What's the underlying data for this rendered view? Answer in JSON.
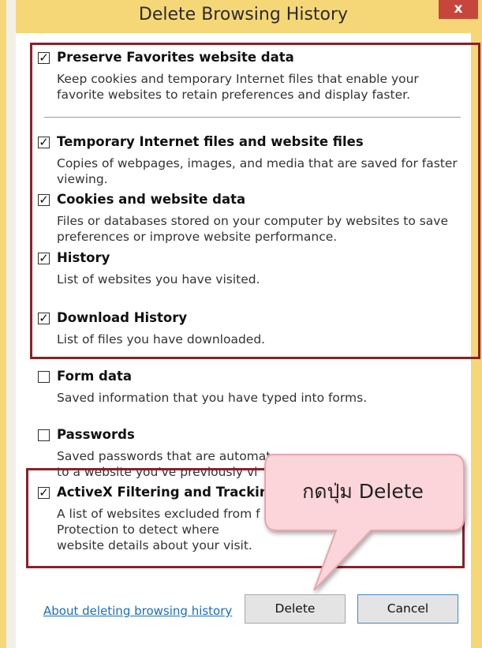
{
  "window": {
    "title": "Delete Browsing History",
    "close_glyph": "x"
  },
  "items": [
    {
      "label": "Preserve Favorites website data",
      "checked": true,
      "description": "Keep cookies and temporary Internet files that enable your favorite websites to retain preferences and display faster."
    },
    {
      "label": "Temporary Internet files and website files",
      "checked": true,
      "description": "Copies of webpages, images, and media that are saved for faster viewing."
    },
    {
      "label": "Cookies and website data",
      "checked": true,
      "description": "Files or databases stored on your computer by websites to save preferences or improve website performance."
    },
    {
      "label": "History",
      "checked": true,
      "description": "List of websites you have visited."
    },
    {
      "label": "Download History",
      "checked": true,
      "description": "List of files you have downloaded."
    },
    {
      "label": "Form data",
      "checked": false,
      "description": "Saved information that you have typed into forms."
    },
    {
      "label": "Passwords",
      "checked": false,
      "description": "Saved passwords that are automati"
    },
    {
      "label": "ActiveX Filtering and Trackin",
      "checked": true,
      "description": "A list of websites excluded from f Protection to detect where website details about your visit."
    }
  ],
  "partial_text": {
    "passwords_line2": "to a website you've previously vi"
  },
  "callout": {
    "text": "กดปุ่ม Delete"
  },
  "footer": {
    "about_link": "About deleting browsing history",
    "delete_label": "Delete",
    "cancel_label": "Cancel"
  },
  "colors": {
    "highlight_border": "#8e1f28",
    "window_frame": "#f6d777",
    "close_button": "#c7463c",
    "link": "#1a6cc4",
    "callout_fill": "#fbd5d9"
  }
}
